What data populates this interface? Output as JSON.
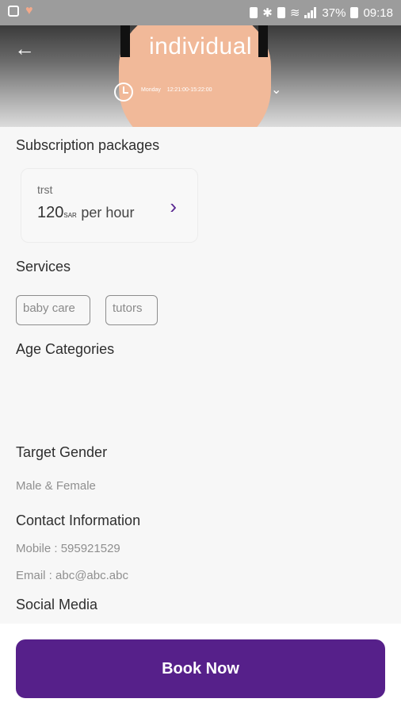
{
  "status_bar": {
    "battery": "37%",
    "time": "09:18"
  },
  "header": {
    "title": "individual",
    "schedule_day": "Monday",
    "schedule_times": "12:21:00-15:22:00"
  },
  "subscription": {
    "heading": "Subscription packages",
    "package": {
      "name": "trst",
      "price": "120",
      "currency": "SAR",
      "period": "per hour"
    }
  },
  "services": {
    "heading": "Services",
    "items": [
      "baby care",
      "tutors"
    ]
  },
  "age_categories": {
    "heading": "Age Categories"
  },
  "target_gender": {
    "heading": "Target Gender",
    "value": "Male & Female"
  },
  "contact": {
    "heading": "Contact Information",
    "mobile": "Mobile : 595921529",
    "email": "Email : abc@abc.abc"
  },
  "social_media": {
    "heading": "Social Media"
  },
  "book_button": {
    "label": "Book Now"
  },
  "colors": {
    "accent": "#56208a",
    "arrow": "#5a2891",
    "background": "#f7f7f7"
  }
}
